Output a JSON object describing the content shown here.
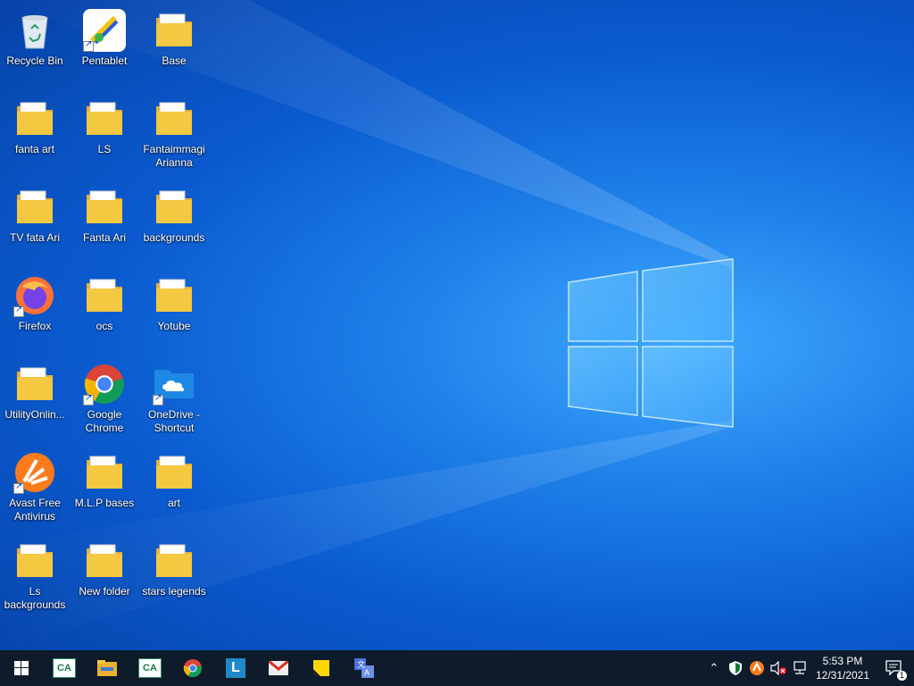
{
  "desktop": {
    "icons": [
      {
        "label": "Recycle Bin",
        "icon": "recycle-bin-icon"
      },
      {
        "label": "Pentablet",
        "icon": "pentablet-app-icon"
      },
      {
        "label": "Base",
        "icon": "folder-icon"
      },
      {
        "label": "fanta art",
        "icon": "folder-icon"
      },
      {
        "label": "LS",
        "icon": "folder-icon"
      },
      {
        "label": "Fantaimmagi Arianna",
        "icon": "folder-icon"
      },
      {
        "label": "TV fata Ari",
        "icon": "folder-icon"
      },
      {
        "label": "Fanta Ari",
        "icon": "folder-icon"
      },
      {
        "label": "backgrounds",
        "icon": "folder-icon"
      },
      {
        "label": "Firefox",
        "icon": "firefox-icon"
      },
      {
        "label": "ocs",
        "icon": "folder-icon"
      },
      {
        "label": "Yotube",
        "icon": "folder-icon"
      },
      {
        "label": "UtilityOnlin...",
        "icon": "folder-icon"
      },
      {
        "label": "Google Chrome",
        "icon": "chrome-icon"
      },
      {
        "label": "OneDrive - Shortcut",
        "icon": "onedrive-folder-icon"
      },
      {
        "label": "Avast Free Antivirus",
        "icon": "avast-icon"
      },
      {
        "label": "M.L.P bases",
        "icon": "folder-icon"
      },
      {
        "label": "art",
        "icon": "folder-icon"
      },
      {
        "label": "Ls backgrounds",
        "icon": "folder-icon"
      },
      {
        "label": "New folder",
        "icon": "folder-icon"
      },
      {
        "label": "stars legends",
        "icon": "folder-icon"
      }
    ]
  },
  "taskbar": {
    "pinned": [
      {
        "name": "start-button",
        "icon": "windows-logo-icon"
      },
      {
        "name": "credit-agricole-1",
        "icon": "credit-agricole-icon",
        "text": "CA"
      },
      {
        "name": "file-explorer",
        "icon": "file-explorer-icon"
      },
      {
        "name": "credit-agricole-2",
        "icon": "credit-agricole-icon",
        "text": "CA"
      },
      {
        "name": "chrome",
        "icon": "chrome-icon"
      },
      {
        "name": "l-app",
        "icon": "l-app-icon",
        "text": "L"
      },
      {
        "name": "mail",
        "icon": "mail-icon"
      },
      {
        "name": "sticky-notes",
        "icon": "sticky-notes-icon"
      },
      {
        "name": "translator",
        "icon": "translate-icon"
      }
    ],
    "tray": {
      "time": "5:53 PM",
      "date": "12/31/2021",
      "notification_count": "1"
    }
  },
  "colors": {
    "taskbar": "#0d1b2a",
    "folder": "#f5c842",
    "wallpaper_accent": "#3fa9ff"
  }
}
